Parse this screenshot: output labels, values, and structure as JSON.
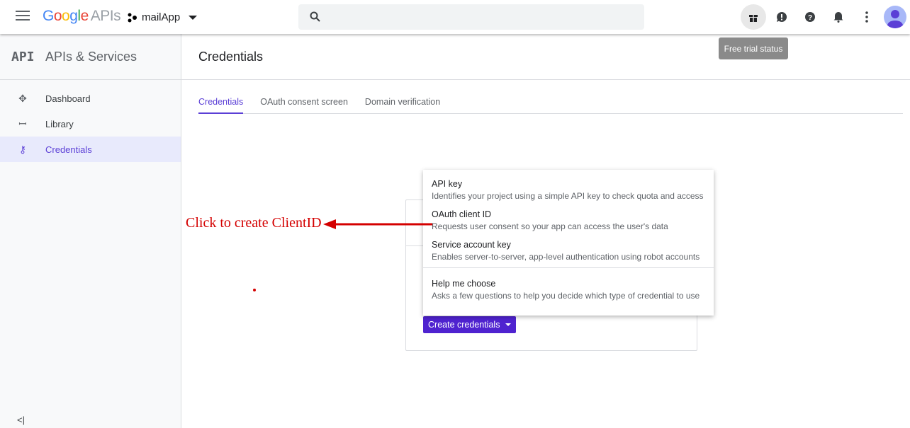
{
  "topbar": {
    "logo_google": "Google",
    "logo_apis": "APIs",
    "project": "mailApp",
    "tooltip": "Free trial status"
  },
  "sidebar": {
    "api_badge": "API",
    "title": "APIs & Services",
    "items": [
      {
        "label": "Dashboard"
      },
      {
        "label": "Library"
      },
      {
        "label": "Credentials"
      }
    ],
    "collapse": "<|"
  },
  "main": {
    "title": "Credentials",
    "tabs": [
      {
        "label": "Credentials"
      },
      {
        "label": "OAuth consent screen"
      },
      {
        "label": "Domain verification"
      }
    ]
  },
  "dropdown": {
    "options": [
      {
        "title": "API key",
        "desc": "Identifies your project using a simple API key to check quota and access"
      },
      {
        "title": "OAuth client ID",
        "desc": "Requests user consent so your app can access the user's data"
      },
      {
        "title": "Service account key",
        "desc": "Enables server-to-server, app-level authentication using robot accounts"
      },
      {
        "title": "Help me choose",
        "desc": "Asks a few questions to help you decide which type of credential to use"
      }
    ]
  },
  "create_button": "Create credentials",
  "annotation": "Click to create ClientID",
  "colors": {
    "accent": "#5b3fd6",
    "button": "#4f23d0",
    "annotation": "#d40000"
  }
}
